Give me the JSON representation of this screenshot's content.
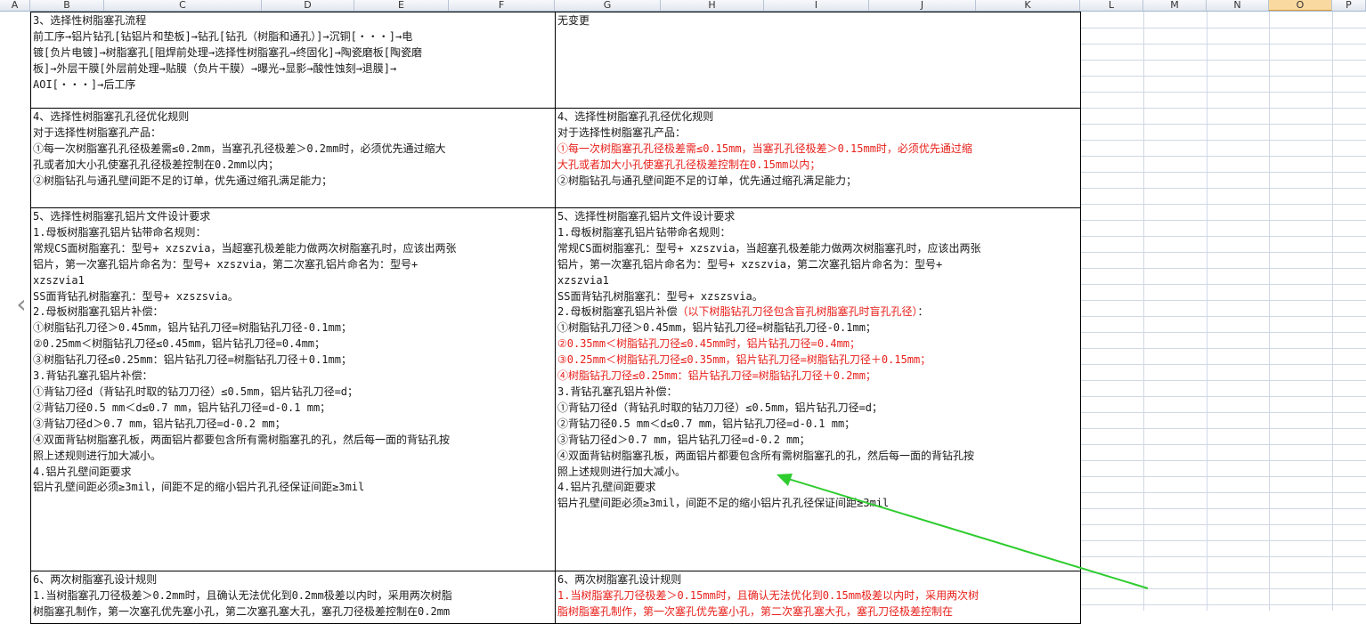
{
  "columns": [
    "A",
    "B",
    "C",
    "D",
    "E",
    "F",
    "G",
    "H",
    "I",
    "J",
    "K",
    "L",
    "M",
    "N",
    "O",
    "P"
  ],
  "selected_column": "O",
  "left": {
    "b3": [
      [
        [
          "3、选择性树脂塞孔流程",
          ""
        ]
      ],
      [
        [
          "前工序→铝片钻孔[钻铝片和垫板]→钻孔[钻孔（树脂和通孔）]→沉铜[・・・]→电",
          ""
        ]
      ],
      [
        [
          "镀[负片电镀]→树脂塞孔[阻焊前处理→选择性树脂塞孔→终固化]→陶瓷磨板[陶瓷磨",
          ""
        ]
      ],
      [
        [
          "板]→外层干膜[外层前处理→贴膜（负片干膜）→曝光→显影→酸性蚀刻→退膜]→",
          ""
        ]
      ],
      [
        [
          "AOI[・・・]→后工序",
          ""
        ]
      ]
    ],
    "b4": [
      [
        [
          "4、选择性树脂塞孔孔径优化规则",
          ""
        ]
      ],
      [
        [
          "对于选择性树脂塞孔产品：",
          ""
        ]
      ],
      [
        [
          "①每一次树脂塞孔孔径极差需≤0.2mm，当塞孔孔径极差＞0.2mm时，必须优先通过缩大",
          ""
        ]
      ],
      [
        [
          "孔或者加大小孔使塞孔孔径极差控制在0.2mm以内；",
          ""
        ]
      ],
      [
        [
          "②树脂钻孔与通孔壁间距不足的订单，优先通过缩孔满足能力；",
          ""
        ]
      ]
    ],
    "b5": [
      [
        [
          "5、选择性树脂塞孔铝片文件设计要求",
          ""
        ]
      ],
      [
        [
          "1.母板树脂塞孔铝片钻带命名规则：",
          ""
        ]
      ],
      [
        [
          "常规CS面树脂塞孔：型号+ xzszvia，当超塞孔极差能力做两次树脂塞孔时，应该出两张",
          ""
        ]
      ],
      [
        [
          "铝片，第一次塞孔铝片命名为：型号+ xzszvia，第二次塞孔铝片命名为：型号+",
          ""
        ]
      ],
      [
        [
          "xzszvia1",
          ""
        ]
      ],
      [
        [
          "SS面背钻孔树脂塞孔：型号+ xzszsvia。",
          ""
        ]
      ],
      [
        [
          "2.母板树脂塞孔铝片补偿：",
          ""
        ]
      ],
      [
        [
          "①树脂钻孔刀径＞0.45mm，铝片钻孔刀径=树脂钻孔刀径-0.1mm；",
          ""
        ]
      ],
      [
        [
          "②0.25mm＜树脂钻孔刀径≤0.45mm，铝片钻孔刀径=0.4mm；",
          ""
        ]
      ],
      [
        [
          "③树脂钻孔刀径≤0.25mm：铝片钻孔刀径=树脂钻孔刀径＋0.1mm；",
          ""
        ]
      ],
      [
        [
          "3.背钻孔塞孔铝片补偿：",
          ""
        ]
      ],
      [
        [
          "①背钻刀径d（背钻孔时取的钻刀刀径）≤0.5mm，铝片钻孔刀径=d；",
          ""
        ]
      ],
      [
        [
          "②背钻刀径0.5 mm＜d≤0.7 mm，铝片钻孔刀径=d-0.1 mm；",
          ""
        ]
      ],
      [
        [
          "③背钻刀径d＞0.7 mm，铝片钻孔刀径=d-0.2 mm；",
          ""
        ]
      ],
      [
        [
          "④双面背钻树脂塞孔板，两面铝片都要包含所有需树脂塞孔的孔，然后每一面的背钻孔按",
          ""
        ]
      ],
      [
        [
          "照上述规则进行加大减小。",
          ""
        ]
      ],
      [
        [
          "4.铝片孔壁间距要求",
          ""
        ]
      ],
      [
        [
          "铝片孔壁间距必须≥3mil，间距不足的缩小铝片孔孔径保证间距≥3mil",
          ""
        ]
      ]
    ],
    "b6": [
      [
        [
          "6、两次树脂塞孔设计规则",
          ""
        ]
      ],
      [
        [
          "1.当树脂塞孔刀径极差＞0.2mm时，且确认无法优化到0.2mm极差以内时，采用两次树脂",
          ""
        ]
      ],
      [
        [
          "树脂塞孔制作，第一次塞孔优先塞小孔，第二次塞孔塞大孔，塞孔刀径极差控制在0.2mm",
          ""
        ]
      ]
    ]
  },
  "right": {
    "g3": [
      [
        [
          "无变更",
          ""
        ]
      ]
    ],
    "g4": [
      [
        [
          "4、选择性树脂塞孔孔径优化规则",
          ""
        ]
      ],
      [
        [
          "对于选择性树脂塞孔产品：",
          ""
        ]
      ],
      [
        [
          "①每一次树脂塞孔孔径极差需≤0.15mm，当塞孔孔径极差＞0.15mm时，必须优先通过缩",
          "red"
        ]
      ],
      [
        [
          "大孔或者加大小孔使塞孔孔径极差控制在0.15mm以内；",
          "red"
        ]
      ],
      [
        [
          "②树脂钻孔与通孔壁间距不足的订单，优先通过缩孔满足能力；",
          ""
        ]
      ]
    ],
    "g5": [
      [
        [
          "5、选择性树脂塞孔铝片文件设计要求",
          ""
        ]
      ],
      [
        [
          "1.母板树脂塞孔铝片钻带命名规则：",
          ""
        ]
      ],
      [
        [
          "常规CS面树脂塞孔：型号+ xzszvia，当超塞孔极差能力做两次树脂塞孔时，应该出两张",
          ""
        ]
      ],
      [
        [
          "铝片，第一次塞孔铝片命名为：型号+ xzszvia，第二次塞孔铝片命名为：型号+",
          ""
        ]
      ],
      [
        [
          "xzszvia1",
          ""
        ]
      ],
      [
        [
          "SS面背钻孔树脂塞孔：型号+ xzszsvia。",
          ""
        ]
      ],
      [
        [
          "2.母板树脂塞孔铝片补偿",
          ""
        ],
        [
          "（以下树脂钻孔刀径包含盲孔树脂塞孔时盲孔孔径）",
          "red"
        ],
        [
          "：",
          ""
        ]
      ],
      [
        [
          "①树脂钻孔刀径＞0.45mm，铝片钻孔刀径=树脂钻孔刀径-0.1mm；",
          ""
        ]
      ],
      [
        [
          "②0.35mm＜树脂钻孔刀径≤0.45mm时，铝片钻孔刀径=0.4mm；",
          "red"
        ]
      ],
      [
        [
          "③0.25mm＜树脂钻孔刀径≤0.35mm，铝片钻孔刀径=树脂钻孔刀径＋0.15mm；",
          "red"
        ]
      ],
      [
        [
          "④树脂钻孔刀径≤0.25mm：铝片钻孔刀径=树脂钻孔刀径＋0.2mm；",
          "red"
        ]
      ],
      [
        [
          "3.背钻孔塞孔铝片补偿：",
          ""
        ]
      ],
      [
        [
          "①背钻刀径d（背钻孔时取的钻刀刀径）≤0.5mm，铝片钻孔刀径=d；",
          ""
        ]
      ],
      [
        [
          "②背钻刀径0.5 mm＜d≤0.7 mm，铝片钻孔刀径=d-0.1 mm；",
          ""
        ]
      ],
      [
        [
          "③背钻刀径d＞0.7 mm，铝片钻孔刀径=d-0.2 mm；",
          ""
        ]
      ],
      [
        [
          "④双面背钻树脂塞孔板，两面铝片都要包含所有需树脂塞孔的孔，然后每一面的背钻孔按",
          ""
        ]
      ],
      [
        [
          "照上述规则进行加大减小。",
          ""
        ]
      ],
      [
        [
          "4.铝片孔壁间距要求",
          ""
        ]
      ],
      [
        [
          "铝片孔壁间距必须≥3mil，间距不足的缩小铝片孔孔径保证间距≥3mil",
          ""
        ]
      ]
    ],
    "g6": [
      [
        [
          "6、两次树脂塞孔设计规则",
          ""
        ]
      ],
      [
        [
          "1.当树脂塞孔刀径极差＞0.15mm时，且确认无法优化到0.15mm极差以内时，采用两次树",
          "red"
        ]
      ],
      [
        [
          "脂树脂塞孔制作，第一次塞孔优先塞小孔，第二次塞孔塞大孔，塞孔刀径极差控制在",
          "red"
        ]
      ]
    ]
  },
  "nav_icon": "chevron-left-icon",
  "annotation_icon": "green-arrow-icon",
  "colors": {
    "red_text": "#e8201b",
    "arrow": "#2ecc2e",
    "selected_header": "#f9d99f"
  }
}
